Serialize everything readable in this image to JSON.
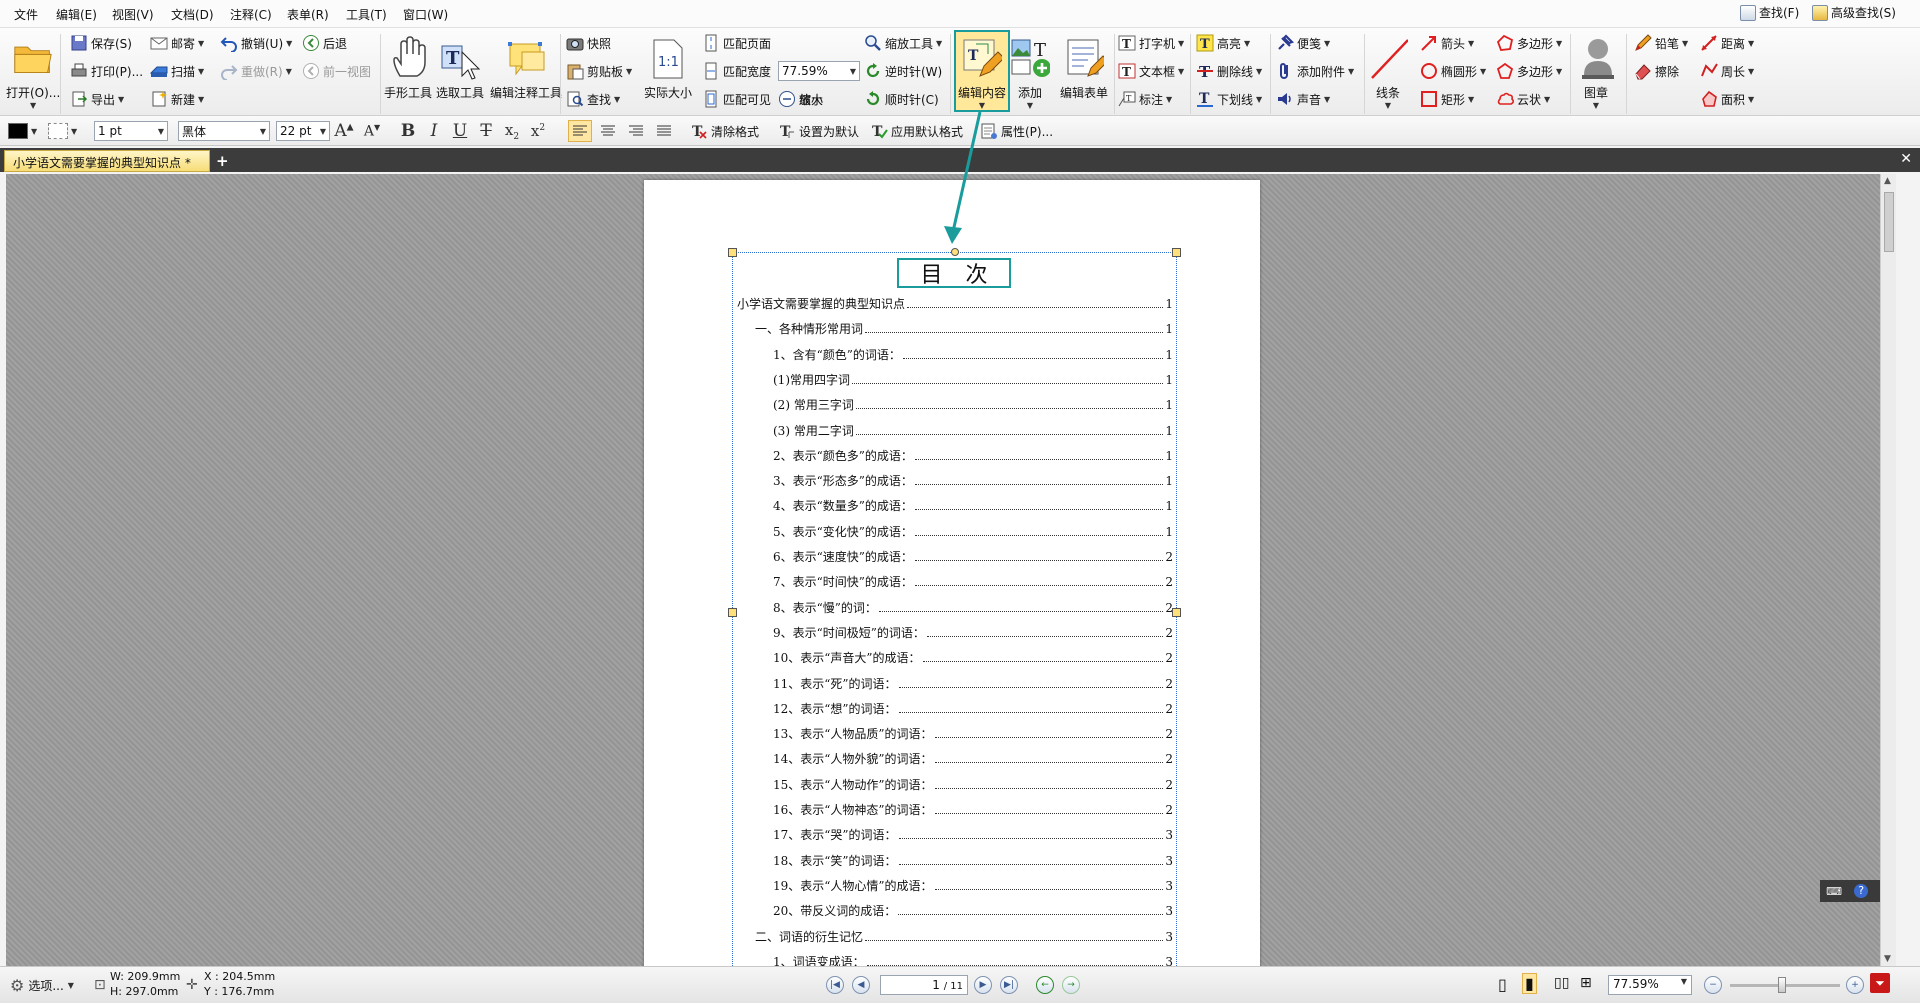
{
  "menu": [
    "文件",
    "编辑(E)",
    "视图(V)",
    "文档(D)",
    "注释(C)",
    "表单(R)",
    "工具(T)",
    "窗口(W)"
  ],
  "find": {
    "find_label": "查找(F)",
    "advanced_find_label": "高级查找(S)"
  },
  "ribbon": {
    "open": "打开(O)...",
    "save": "保存(S)",
    "print": "打印(P)...",
    "export": "导出",
    "email": "邮寄",
    "scan": "扫描",
    "new": "新建",
    "undo": "撤销(U)",
    "redo": "重做(R)",
    "back": "后退",
    "prev_view": "前一视图",
    "hand_tool": "手形工具",
    "select_tool": "选取工具",
    "edit_annot_tool": "编辑注释工具",
    "snapshot": "快照",
    "clipboard": "剪贴板",
    "search": "查找",
    "actual_size": "实际大小",
    "fit_page": "匹配页面",
    "fit_width": "匹配宽度",
    "fit_visible": "匹配可见",
    "zoom_value": "77.59%",
    "zoom_tool": "缩放工具",
    "zoom_in": "放大",
    "zoom_out": "缩小",
    "rotate_ccw": "逆时针(W)",
    "rotate_cw": "顺时针(C)",
    "edit_content": "编辑内容",
    "add": "添加",
    "edit_form": "编辑表单",
    "typewriter": "打字机",
    "textbox": "文本框",
    "callout": "标注",
    "highlight": "高亮",
    "strikeout": "删除线",
    "underline": "下划线",
    "note": "便笺",
    "attach": "添加附件",
    "sound": "声音",
    "line": "线条",
    "arrow": "箭头",
    "ellipse": "椭圆形",
    "rectangle": "矩形",
    "polygon": "多边形",
    "polyline": "多边形",
    "cloud": "云状",
    "stamp": "图章",
    "pencil": "铅笔",
    "eraser": "擦除",
    "distance": "距离",
    "perimeter": "周长",
    "area": "面积"
  },
  "format": {
    "stroke_width": "1 pt",
    "font": "黑体",
    "font_size": "22 pt",
    "clear_format": "清除格式",
    "set_default": "设置为默认",
    "apply_default": "应用默认格式",
    "properties": "属性(P)..."
  },
  "tab": {
    "title": "小学语文需要掌握的典型知识点 *"
  },
  "document": {
    "toc_title_chars": [
      "目",
      "次"
    ],
    "toc": [
      {
        "text": "小学语文需要掌握的典型知识点",
        "page": "1",
        "level": 0
      },
      {
        "text": "一、各种情形常用词",
        "page": "1",
        "level": 1
      },
      {
        "text": "1、含有“颜色”的词语：",
        "page": "1",
        "level": 2
      },
      {
        "text": "(1)常用四字词",
        "page": "1",
        "level": 2
      },
      {
        "text": "(2) 常用三字词",
        "page": "1",
        "level": 2
      },
      {
        "text": "(3) 常用二字词",
        "page": "1",
        "level": 2
      },
      {
        "text": "2、表示“颜色多”的成语：",
        "page": "1",
        "level": 2
      },
      {
        "text": "3、表示“形态多”的成语：",
        "page": "1",
        "level": 2
      },
      {
        "text": "4、表示“数量多”的成语：",
        "page": "1",
        "level": 2
      },
      {
        "text": "5、表示“变化快”的成语：",
        "page": "1",
        "level": 2
      },
      {
        "text": "6、表示“速度快”的成语：",
        "page": "2",
        "level": 2
      },
      {
        "text": "7、表示“时间快”的成语：",
        "page": "2",
        "level": 2
      },
      {
        "text": "8、表示“慢”的词：",
        "page": "2",
        "level": 2
      },
      {
        "text": "9、表示“时间极短”的词语：",
        "page": "2",
        "level": 2
      },
      {
        "text": "10、表示“声音大”的成语：",
        "page": "2",
        "level": 2
      },
      {
        "text": "11、表示“死”的词语：",
        "page": "2",
        "level": 2
      },
      {
        "text": "12、表示“想”的词语：",
        "page": "2",
        "level": 2
      },
      {
        "text": "13、表示“人物品质”的词语：",
        "page": "2",
        "level": 2
      },
      {
        "text": "14、表示“人物外貌”的词语：",
        "page": "2",
        "level": 2
      },
      {
        "text": "15、表示“人物动作”的词语：",
        "page": "2",
        "level": 2
      },
      {
        "text": "16、表示“人物神态”的词语：",
        "page": "2",
        "level": 2
      },
      {
        "text": "17、表示“哭”的词语：",
        "page": "3",
        "level": 2
      },
      {
        "text": "18、表示“笑”的词语：",
        "page": "3",
        "level": 2
      },
      {
        "text": "19、表示“人物心情”的成语：",
        "page": "3",
        "level": 2
      },
      {
        "text": "20、带反义词的成语：",
        "page": "3",
        "level": 2
      },
      {
        "text": "二、词语的衍生记忆",
        "page": "3",
        "level": 1
      },
      {
        "text": "1、词语变成语：",
        "page": "3",
        "level": 2
      }
    ]
  },
  "status": {
    "options": "选项...",
    "width": "W: 209.9mm",
    "height": "H: 297.0mm",
    "x": "X : 204.5mm",
    "y": "Y : 176.7mm",
    "page_input": "1",
    "page_total": "/ 11",
    "zoom": "77.59%"
  },
  "colors": {
    "accent_teal": "#1a9c9c",
    "highlight_yellow": "#ffe89a"
  }
}
